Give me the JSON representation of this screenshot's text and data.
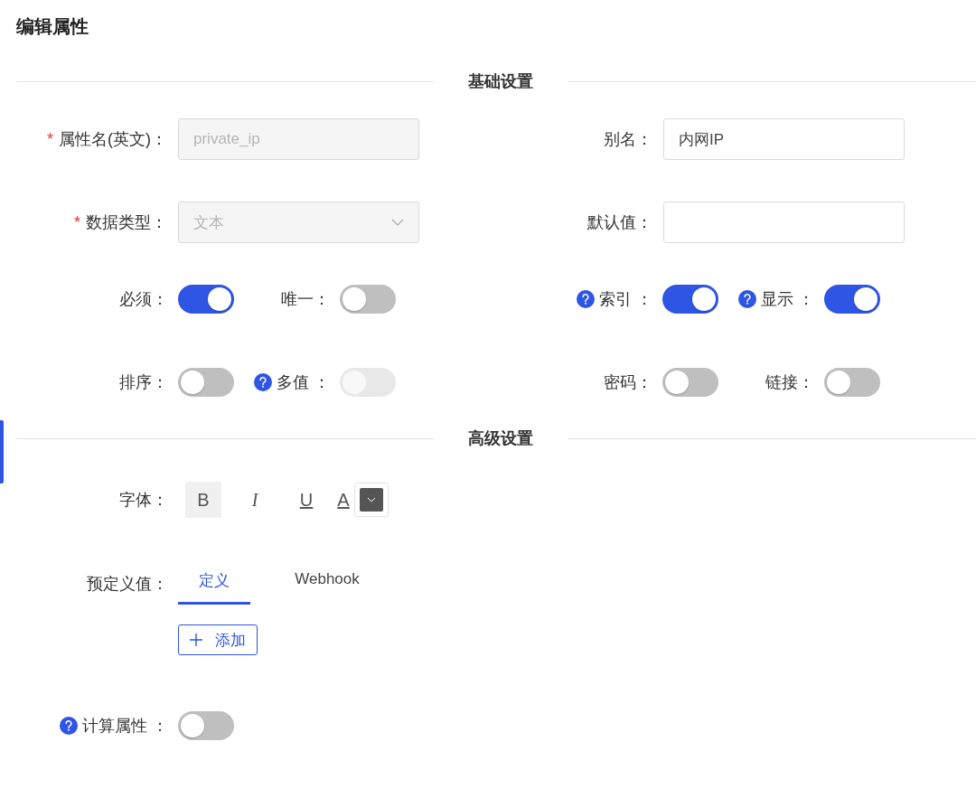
{
  "title": "编辑属性",
  "basic": {
    "heading": "基础设置",
    "fields": [
      {
        "kind": "input",
        "label": "属性名(英文)：",
        "required_mark": "*",
        "value": "private_ip",
        "disabled": true
      },
      {
        "kind": "input",
        "label": "别名：",
        "value": "内网IP"
      },
      {
        "kind": "select",
        "label": "数据类型：",
        "required_mark": "*",
        "value": "文本",
        "disabled": true
      },
      {
        "kind": "input",
        "label": "默认值："
      }
    ],
    "switches": [
      {
        "label": "必须：",
        "help": false,
        "on": true,
        "disabled": false
      },
      {
        "label": "唯一：",
        "help": false,
        "on": false,
        "disabled": false
      },
      {
        "label": "索引 ：",
        "help": true,
        "on": true,
        "disabled": false
      },
      {
        "label": "显示 ：",
        "help": true,
        "on": true,
        "disabled": false
      },
      {
        "label": "排序：",
        "help": false,
        "on": false,
        "disabled": false
      },
      {
        "label": "多值 ：",
        "help": true,
        "on": false,
        "disabled": true
      },
      {
        "label": "密码：",
        "help": false,
        "on": false,
        "disabled": false
      },
      {
        "label": "链接：",
        "help": false,
        "on": false,
        "disabled": false
      }
    ]
  },
  "advanced": {
    "heading": "高级设置",
    "font": {
      "label": "字体：",
      "styles": [
        {
          "kind": "bold",
          "label": "B",
          "selected": true
        },
        {
          "kind": "italic",
          "label": "I",
          "selected": false
        },
        {
          "kind": "underline",
          "label": "U",
          "selected": false
        },
        {
          "kind": "color",
          "label": "A",
          "selected": false,
          "color": "#555555"
        }
      ]
    },
    "predefined": {
      "label": "预定义值：",
      "tabs": [
        {
          "label": "定义",
          "selected": true
        },
        {
          "label": "Webhook",
          "selected": false
        }
      ],
      "add_button": "添加"
    },
    "computed": {
      "label": "计算属性 ：",
      "help": true,
      "on": false,
      "disabled": false
    }
  }
}
